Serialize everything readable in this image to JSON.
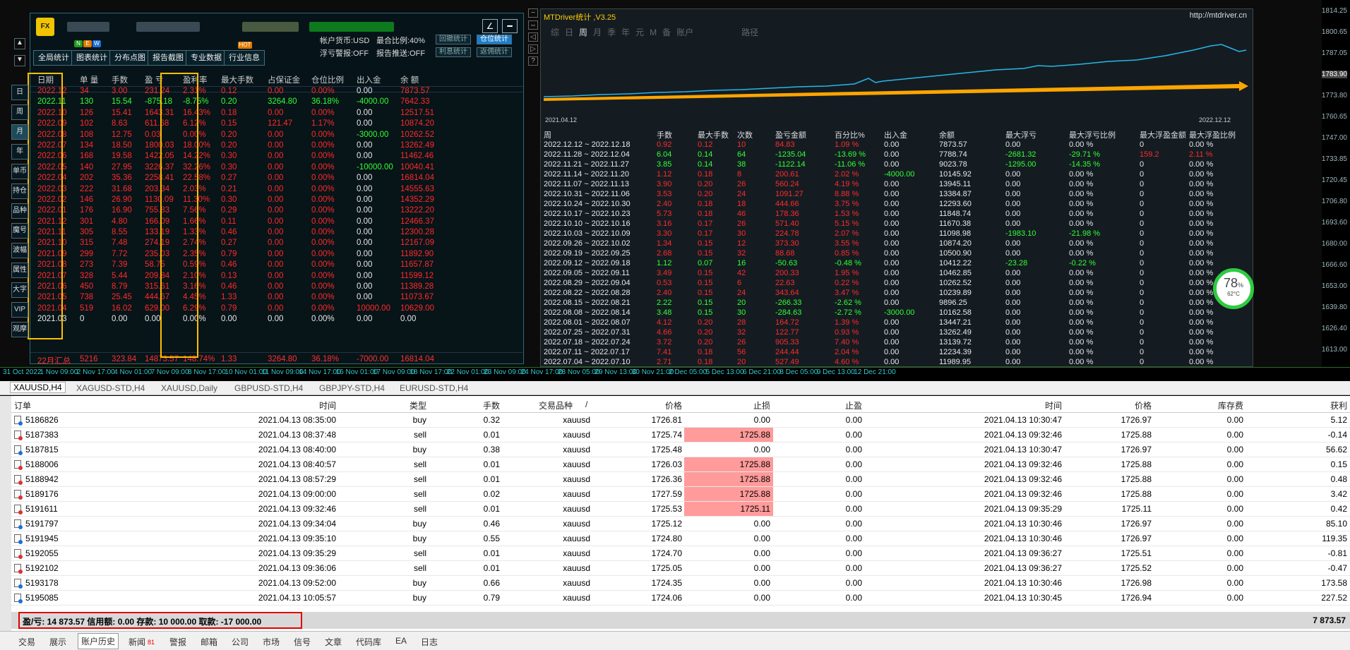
{
  "stats": {
    "nav_buttons": [
      "全局统计",
      "图表统计",
      "分布点图",
      "报告截图",
      "专业数据",
      "行业信息"
    ],
    "badges": [
      "N",
      "E",
      "W"
    ],
    "hot_badge": "HOT",
    "info": {
      "currency": "帐户货币:USD",
      "max_position": "最合比例:40%",
      "float_warn": "浮亏警报:OFF",
      "report_push": "报告推送:OFF"
    },
    "right_buttons": [
      "回撤统计",
      "仓位统计",
      "利息统计",
      "返佣统计"
    ],
    "side_tabs": [
      "日",
      "周",
      "月",
      "年",
      "单币",
      "持仓",
      "品种",
      "魔号",
      "波幅",
      "属性",
      "大字",
      "VIP",
      "观摩"
    ],
    "headers": [
      "日期",
      "单 量",
      "手数",
      "盈 亏",
      "盈利率",
      "最大手数",
      "占保证金",
      "仓位比例",
      "出入金",
      "余 额"
    ],
    "rows": [
      [
        "2022.12",
        "34",
        "3.00",
        "231.24",
        "2.31%",
        "0.12",
        "0.00",
        "0.00%",
        "0.00",
        "7873.57",
        "r"
      ],
      [
        "2022.11",
        "130",
        "15.54",
        "-875.18",
        "-8.75%",
        "0.20",
        "3264.80",
        "36.18%",
        "-4000.00",
        "7642.33",
        "g"
      ],
      [
        "2022.10",
        "126",
        "15.41",
        "1643.31",
        "16.43%",
        "0.18",
        "0.00",
        "0.00%",
        "0.00",
        "12517.51",
        "r"
      ],
      [
        "2022.09",
        "102",
        "8.63",
        "611.68",
        "6.12%",
        "0.15",
        "121.47",
        "1.17%",
        "0.00",
        "10874.20",
        "r"
      ],
      [
        "2022.08",
        "108",
        "12.75",
        "0.03",
        "0.00%",
        "0.20",
        "0.00",
        "0.00%",
        "-3000.00",
        "10262.52",
        "r"
      ],
      [
        "2022.07",
        "134",
        "18.50",
        "1800.03",
        "18.00%",
        "0.20",
        "0.00",
        "0.00%",
        "0.00",
        "13262.49",
        "r"
      ],
      [
        "2022.06",
        "168",
        "19.58",
        "1422.05",
        "14.22%",
        "0.30",
        "0.00",
        "0.00%",
        "0.00",
        "11462.46",
        "r"
      ],
      [
        "2022.05",
        "140",
        "27.95",
        "3226.37",
        "32.26%",
        "0.30",
        "0.00",
        "0.00%",
        "-10000.00",
        "10040.41",
        "r"
      ],
      [
        "2022.04",
        "202",
        "35.36",
        "2258.41",
        "22.58%",
        "0.27",
        "0.00",
        "0.00%",
        "0.00",
        "16814.04",
        "r"
      ],
      [
        "2022.03",
        "222",
        "31.68",
        "203.34",
        "2.03%",
        "0.21",
        "0.00",
        "0.00%",
        "0.00",
        "14555.63",
        "r"
      ],
      [
        "2022.02",
        "146",
        "26.90",
        "1130.09",
        "11.30%",
        "0.30",
        "0.00",
        "0.00%",
        "0.00",
        "14352.29",
        "r"
      ],
      [
        "2022.01",
        "176",
        "16.90",
        "755.83",
        "7.56%",
        "0.29",
        "0.00",
        "0.00%",
        "0.00",
        "13222.20",
        "r"
      ],
      [
        "2021.12",
        "301",
        "4.80",
        "166.09",
        "1.66%",
        "0.11",
        "0.00",
        "0.00%",
        "0.00",
        "12466.37",
        "r"
      ],
      [
        "2021.11",
        "305",
        "8.55",
        "133.19",
        "1.33%",
        "0.46",
        "0.00",
        "0.00%",
        "0.00",
        "12300.28",
        "r"
      ],
      [
        "2021.10",
        "315",
        "7.48",
        "274.19",
        "2.74%",
        "0.27",
        "0.00",
        "0.00%",
        "0.00",
        "12167.09",
        "r"
      ],
      [
        "2021.09",
        "299",
        "7.72",
        "235.03",
        "2.35%",
        "0.79",
        "0.00",
        "0.00%",
        "0.00",
        "11892.90",
        "r"
      ],
      [
        "2021.08",
        "273",
        "7.39",
        "58.75",
        "0.59%",
        "0.46",
        "0.00",
        "0.00%",
        "0.00",
        "11657.87",
        "r"
      ],
      [
        "2021.07",
        "328",
        "5.44",
        "209.84",
        "2.10%",
        "0.13",
        "0.00",
        "0.00%",
        "0.00",
        "11599.12",
        "r"
      ],
      [
        "2021.06",
        "450",
        "8.79",
        "315.61",
        "3.16%",
        "0.46",
        "0.00",
        "0.00%",
        "0.00",
        "11389.28",
        "r"
      ],
      [
        "2021.05",
        "738",
        "25.45",
        "444.67",
        "4.45%",
        "1.33",
        "0.00",
        "0.00%",
        "0.00",
        "11073.67",
        "r"
      ],
      [
        "2021.04",
        "519",
        "16.02",
        "629.00",
        "6.29%",
        "0.79",
        "0.00",
        "0.00%",
        "10000.00",
        "10629.00",
        "r"
      ],
      [
        "2021.03",
        "0",
        "0.00",
        "0.00",
        "0.00%",
        "0.00",
        "0.00",
        "0.00%",
        "0.00",
        "0.00",
        "w"
      ]
    ],
    "summary": [
      "22月汇总",
      "5216",
      "323.84",
      "14873.57",
      "148.74%",
      "1.33",
      "3264.80",
      "36.18%",
      "-7000.00",
      "16814.04"
    ]
  },
  "report": {
    "title": "MTDriver统计 ,V3.25",
    "url": "http://mtdriver.cn",
    "tabs": [
      "综",
      "日",
      "周",
      "月",
      "季",
      "年",
      "元",
      "M",
      "备",
      "账户",
      "路径"
    ],
    "chart_start": "2021.04.12",
    "chart_end": "2022.12.12",
    "headers": [
      "周",
      "手数",
      "最大手数",
      "次数",
      "盈亏金额",
      "百分比%",
      "出入金",
      "余额",
      "最大浮亏",
      "最大浮亏比例",
      "最大浮盈金额",
      "最大浮盈比例"
    ],
    "rows": [
      [
        "2022.12.12 ~ 2022.12.18",
        "0.92",
        "0.12",
        "10",
        "84.83",
        "1.09 %",
        "0.00",
        "7873.57",
        "0.00",
        "0.00 %",
        "0",
        "0.00 %",
        "r"
      ],
      [
        "2022.11.28 ~ 2022.12.04",
        "6.04",
        "0.14",
        "64",
        "-1235.04",
        "-13.69 %",
        "0.00",
        "7788.74",
        "-2681.32",
        "-29.71 %",
        "159.2",
        "2.11 %",
        "g"
      ],
      [
        "2022.11.21 ~ 2022.11.27",
        "3.85",
        "0.14",
        "38",
        "-1122.14",
        "-11.06 %",
        "0.00",
        "9023.78",
        "-1295.00",
        "-14.35 %",
        "0",
        "0.00 %",
        "g"
      ],
      [
        "2022.11.14 ~ 2022.11.20",
        "1.12",
        "0.18",
        "8",
        "200.61",
        "2.02 %",
        "-4000.00",
        "10145.92",
        "0.00",
        "0.00 %",
        "0",
        "0.00 %",
        "r"
      ],
      [
        "2022.11.07 ~ 2022.11.13",
        "3.90",
        "0.20",
        "26",
        "560.24",
        "4.19 %",
        "0.00",
        "13945.11",
        "0.00",
        "0.00 %",
        "0",
        "0.00 %",
        "r"
      ],
      [
        "2022.10.31 ~ 2022.11.06",
        "3.53",
        "0.20",
        "24",
        "1091.27",
        "8.88 %",
        "0.00",
        "13384.87",
        "0.00",
        "0.00 %",
        "0",
        "0.00 %",
        "r"
      ],
      [
        "2022.10.24 ~ 2022.10.30",
        "2.40",
        "0.18",
        "18",
        "444.66",
        "3.75 %",
        "0.00",
        "12293.60",
        "0.00",
        "0.00 %",
        "0",
        "0.00 %",
        "r"
      ],
      [
        "2022.10.17 ~ 2022.10.23",
        "5.73",
        "0.18",
        "46",
        "178.36",
        "1.53 %",
        "0.00",
        "11848.74",
        "0.00",
        "0.00 %",
        "0",
        "0.00 %",
        "r"
      ],
      [
        "2022.10.10 ~ 2022.10.16",
        "3.16",
        "0.17",
        "26",
        "571.40",
        "5.15 %",
        "0.00",
        "11670.38",
        "0.00",
        "0.00 %",
        "0",
        "0.00 %",
        "r"
      ],
      [
        "2022.10.03 ~ 2022.10.09",
        "3.30",
        "0.17",
        "30",
        "224.78",
        "2.07 %",
        "0.00",
        "11098.98",
        "-1983.10",
        "-21.98 %",
        "0",
        "0.00 %",
        "r"
      ],
      [
        "2022.09.26 ~ 2022.10.02",
        "1.34",
        "0.15",
        "12",
        "373.30",
        "3.55 %",
        "0.00",
        "10874.20",
        "0.00",
        "0.00 %",
        "0",
        "0.00 %",
        "r"
      ],
      [
        "2022.09.19 ~ 2022.09.25",
        "2.68",
        "0.15",
        "32",
        "88.68",
        "0.85 %",
        "0.00",
        "10500.90",
        "0.00",
        "0.00 %",
        "0",
        "0.00 %",
        "r"
      ],
      [
        "2022.09.12 ~ 2022.09.18",
        "1.12",
        "0.07",
        "16",
        "-50.63",
        "-0.48 %",
        "0.00",
        "10412.22",
        "-23.28",
        "-0.22 %",
        "0",
        "0.00 %",
        "g"
      ],
      [
        "2022.09.05 ~ 2022.09.11",
        "3.49",
        "0.15",
        "42",
        "200.33",
        "1.95 %",
        "0.00",
        "10462.85",
        "0.00",
        "0.00 %",
        "0",
        "0.00 %",
        "r"
      ],
      [
        "2022.08.29 ~ 2022.09.04",
        "0.53",
        "0.15",
        "6",
        "22.63",
        "0.22 %",
        "0.00",
        "10262.52",
        "0.00",
        "0.00 %",
        "0",
        "0.00 %",
        "r"
      ],
      [
        "2022.08.22 ~ 2022.08.28",
        "2.40",
        "0.15",
        "24",
        "343.64",
        "3.47 %",
        "0.00",
        "10239.89",
        "0.00",
        "0.00 %",
        "0",
        "0.00 %",
        "r"
      ],
      [
        "2022.08.15 ~ 2022.08.21",
        "2.22",
        "0.15",
        "20",
        "-266.33",
        "-2.62 %",
        "0.00",
        "9896.25",
        "0.00",
        "0.00 %",
        "0",
        "0.00 %",
        "g"
      ],
      [
        "2022.08.08 ~ 2022.08.14",
        "3.48",
        "0.15",
        "30",
        "-284.63",
        "-2.72 %",
        "-3000.00",
        "10162.58",
        "0.00",
        "0.00 %",
        "0",
        "0.00 %",
        "g"
      ],
      [
        "2022.08.01 ~ 2022.08.07",
        "4.12",
        "0.20",
        "28",
        "164.72",
        "1.39 %",
        "0.00",
        "13447.21",
        "0.00",
        "0.00 %",
        "0",
        "0.00 %",
        "r"
      ],
      [
        "2022.07.25 ~ 2022.07.31",
        "4.66",
        "0.20",
        "32",
        "122.77",
        "0.93 %",
        "0.00",
        "13262.49",
        "0.00",
        "0.00 %",
        "0",
        "0.00 %",
        "r"
      ],
      [
        "2022.07.18 ~ 2022.07.24",
        "3.72",
        "0.20",
        "26",
        "905.33",
        "7.40 %",
        "0.00",
        "13139.72",
        "0.00",
        "0.00 %",
        "0",
        "0.00 %",
        "r"
      ],
      [
        "2022.07.11 ~ 2022.07.17",
        "7.41",
        "0.18",
        "56",
        "244.44",
        "2.04 %",
        "0.00",
        "12234.39",
        "0.00",
        "0.00 %",
        "0",
        "0.00 %",
        "r"
      ],
      [
        "2022.07.04 ~ 2022.07.10",
        "2.71",
        "0.18",
        "20",
        "527.49",
        "4.60 %",
        "0.00",
        "11989.95",
        "0.00",
        "0.00 %",
        "0",
        "0.00 %",
        "r"
      ]
    ]
  },
  "gauge": {
    "value": "78",
    "unit": "%",
    "temp": "62°C"
  },
  "price_scale": [
    "1814.25",
    "1800.65",
    "1787.05",
    "1783.90",
    "1773.80",
    "1760.65",
    "1747.00",
    "1733.85",
    "1720.45",
    "1706.80",
    "1693.60",
    "1680.00",
    "1666.60",
    "1653.00",
    "1639.80",
    "1626.40",
    "1613.00"
  ],
  "time_axis": [
    "31 Oct 2022",
    "1 Nov 09:00",
    "2 Nov 17:00",
    "4 Nov 01:00",
    "7 Nov 09:00",
    "8 Nov 17:00",
    "10 Nov 01:00",
    "11 Nov 09:00",
    "14 Nov 17:00",
    "16 Nov 01:00",
    "17 Nov 09:00",
    "18 Nov 17:00",
    "22 Nov 01:00",
    "23 Nov 09:00",
    "24 Nov 17:00",
    "28 Nov 05:00",
    "29 Nov 13:00",
    "30 Nov 21:00",
    "2 Dec 05:00",
    "5 Dec 13:00",
    "6 Dec 21:00",
    "8 Dec 05:00",
    "9 Dec 13:00",
    "12 Dec 21:00"
  ],
  "symbol_tabs": [
    "XAUUSD,H4",
    "XAGUSD-STD,H4",
    "XAUUSD,Daily",
    "GBPUSD-STD,H4",
    "GBPJPY-STD,H4",
    "EURUSD-STD,H4"
  ],
  "terminal": {
    "headers": [
      "订单",
      "时间",
      "类型",
      "手数",
      "交易品种",
      "/",
      "价格",
      "止损",
      "止盈",
      "时间",
      "价格",
      "库存费",
      "获利"
    ],
    "rows": [
      [
        "5186826",
        "2021.04.13 08:35:00",
        "buy",
        "0.32",
        "xauusd",
        "1726.81",
        "0.00",
        "0.00",
        "2021.04.13 10:30:47",
        "1726.97",
        "0.00",
        "5.12",
        false
      ],
      [
        "5187383",
        "2021.04.13 08:37:48",
        "sell",
        "0.01",
        "xauusd",
        "1725.74",
        "1725.88",
        "0.00",
        "2021.04.13 09:32:46",
        "1725.88",
        "0.00",
        "-0.14",
        true
      ],
      [
        "5187815",
        "2021.04.13 08:40:00",
        "buy",
        "0.38",
        "xauusd",
        "1725.48",
        "0.00",
        "0.00",
        "2021.04.13 10:30:47",
        "1726.97",
        "0.00",
        "56.62",
        false
      ],
      [
        "5188006",
        "2021.04.13 08:40:57",
        "sell",
        "0.01",
        "xauusd",
        "1726.03",
        "1725.88",
        "0.00",
        "2021.04.13 09:32:46",
        "1725.88",
        "0.00",
        "0.15",
        true
      ],
      [
        "5188942",
        "2021.04.13 08:57:29",
        "sell",
        "0.01",
        "xauusd",
        "1726.36",
        "1725.88",
        "0.00",
        "2021.04.13 09:32:46",
        "1725.88",
        "0.00",
        "0.48",
        true
      ],
      [
        "5189176",
        "2021.04.13 09:00:00",
        "sell",
        "0.02",
        "xauusd",
        "1727.59",
        "1725.88",
        "0.00",
        "2021.04.13 09:32:46",
        "1725.88",
        "0.00",
        "3.42",
        true
      ],
      [
        "5191611",
        "2021.04.13 09:32:46",
        "sell",
        "0.01",
        "xauusd",
        "1725.53",
        "1725.11",
        "0.00",
        "2021.04.13 09:35:29",
        "1725.11",
        "0.00",
        "0.42",
        true
      ],
      [
        "5191797",
        "2021.04.13 09:34:04",
        "buy",
        "0.46",
        "xauusd",
        "1725.12",
        "0.00",
        "0.00",
        "2021.04.13 10:30:46",
        "1726.97",
        "0.00",
        "85.10",
        false
      ],
      [
        "5191945",
        "2021.04.13 09:35:10",
        "buy",
        "0.55",
        "xauusd",
        "1724.80",
        "0.00",
        "0.00",
        "2021.04.13 10:30:46",
        "1726.97",
        "0.00",
        "119.35",
        false
      ],
      [
        "5192055",
        "2021.04.13 09:35:29",
        "sell",
        "0.01",
        "xauusd",
        "1724.70",
        "0.00",
        "0.00",
        "2021.04.13 09:36:27",
        "1725.51",
        "0.00",
        "-0.81",
        false
      ],
      [
        "5192102",
        "2021.04.13 09:36:06",
        "sell",
        "0.01",
        "xauusd",
        "1725.05",
        "0.00",
        "0.00",
        "2021.04.13 09:36:27",
        "1725.52",
        "0.00",
        "-0.47",
        false
      ],
      [
        "5193178",
        "2021.04.13 09:52:00",
        "buy",
        "0.66",
        "xauusd",
        "1724.35",
        "0.00",
        "0.00",
        "2021.04.13 10:30:46",
        "1726.98",
        "0.00",
        "173.58",
        false
      ],
      [
        "5195085",
        "2021.04.13 10:05:57",
        "buy",
        "0.79",
        "xauusd",
        "1724.06",
        "0.00",
        "0.00",
        "2021.04.13 10:30:45",
        "1726.94",
        "0.00",
        "227.52",
        false
      ]
    ],
    "balance_text": "盈/亏: 14 873.57  信用额: 0.00  存款: 10 000.00  取款: -17 000.00",
    "balance_total": "7 873.57"
  },
  "bottom_tabs": [
    "交易",
    "展示",
    "账户历史",
    "新闻",
    "警报",
    "邮箱",
    "公司",
    "市场",
    "信号",
    "文章",
    "代码库",
    "EA",
    "日志"
  ],
  "news_count": "81",
  "colors": {
    "profit": "#ff2a2a",
    "loss": "#32ff32",
    "stop_loss_hit": "#ff9b9b",
    "highlight": "#ffbf00"
  }
}
